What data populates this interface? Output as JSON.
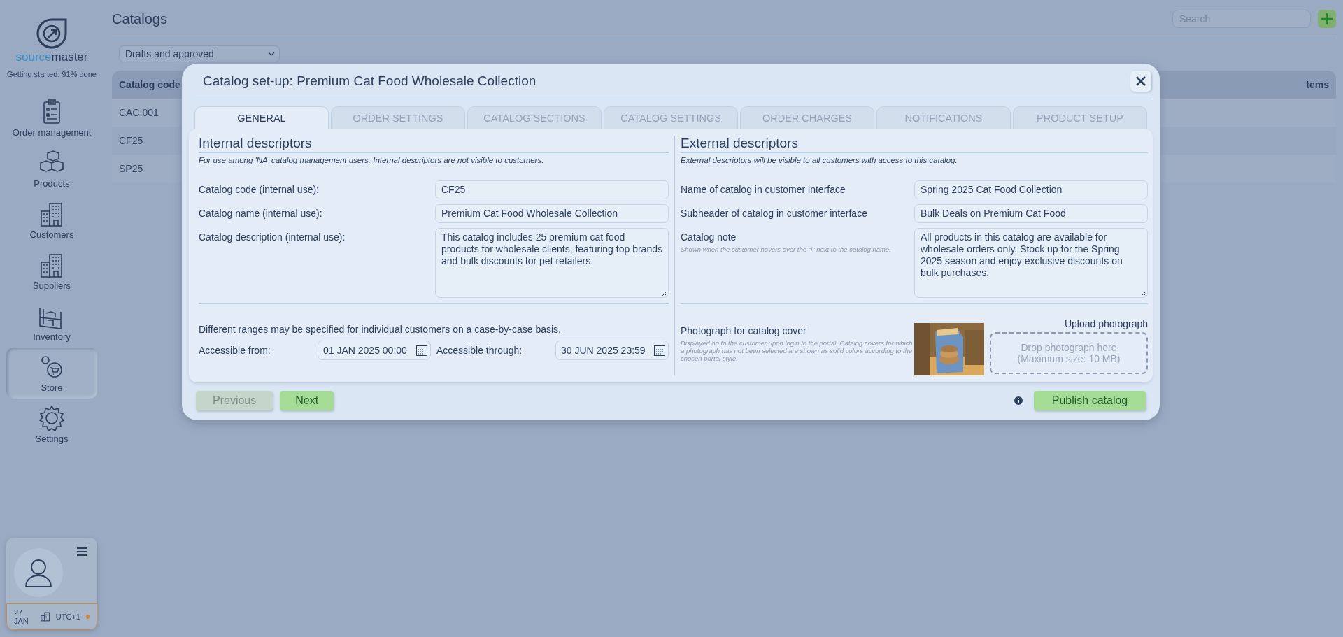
{
  "sidebar": {
    "logo": {
      "part_1": "source",
      "part_2": "master"
    },
    "getting_started": "Getting started: 91% done",
    "nav": [
      {
        "label": "Order management",
        "selected": false
      },
      {
        "label": "Products",
        "selected": false
      },
      {
        "label": "Customers",
        "selected": false
      },
      {
        "label": "Suppliers",
        "selected": false
      },
      {
        "label": "Inventory",
        "selected": false
      },
      {
        "label": "Store",
        "selected": true
      },
      {
        "label": "Settings",
        "selected": false
      }
    ],
    "user": {
      "date": "27 JAN",
      "timezone": "UTC+1"
    }
  },
  "page": {
    "title": "Catalogs",
    "search": {
      "placeholder": "Search"
    },
    "filter": "Drafts and approved",
    "table": {
      "columns": [
        "Catalog code",
        "tems"
      ],
      "rows": [
        [
          "CAC.001"
        ],
        [
          "CF25"
        ],
        [
          "SP25"
        ]
      ]
    }
  },
  "modal": {
    "title": "Catalog set-up: Premium Cat Food Wholesale Collection",
    "tabs": [
      {
        "label": "GENERAL",
        "selected": true
      },
      {
        "label": "ORDER SETTINGS",
        "selected": false
      },
      {
        "label": "CATALOG SECTIONS",
        "selected": false
      },
      {
        "label": "CATALOG SETTINGS",
        "selected": false
      },
      {
        "label": "ORDER CHARGES",
        "selected": false
      },
      {
        "label": "NOTIFICATIONS",
        "selected": false
      },
      {
        "label": "PRODUCT SETUP",
        "selected": false
      }
    ],
    "internal": {
      "heading": "Internal descriptors",
      "note": "For use among 'NA' catalog management users. Internal descriptors are not visible to customers.",
      "fields": [
        {
          "kind": "input",
          "label": "Catalog code (internal use):",
          "value": "CF25"
        },
        {
          "kind": "input",
          "label": "Catalog name (internal use):",
          "value": "Premium Cat Food Wholesale Collection"
        },
        {
          "kind": "textarea",
          "label": "Catalog description (internal use):",
          "value": "This catalog includes 25 premium cat food products for wholesale clients, featuring top brands and bulk discounts for pet retailers."
        }
      ],
      "range_note": "Different ranges may be specified for individual customers on a case-by-case basis.",
      "from_label": "Accessible from:",
      "from_value": "01 JAN 2025 00:00",
      "through_label": "Accessible through:",
      "through_value": "30 JUN 2025 23:59"
    },
    "external": {
      "heading": "External descriptors",
      "note": "External descriptors will be visible to all customers with access to this catalog.",
      "fields": [
        {
          "kind": "input",
          "label": "Name of catalog in customer interface",
          "value": "Spring 2025 Cat Food Collection"
        },
        {
          "kind": "input",
          "label": "Subheader of catalog in customer interface",
          "value": "Bulk Deals on Premium Cat Food"
        },
        {
          "kind": "textarea",
          "label": "Catalog note",
          "hint": "Shown when the customer hovers over the \"i\" next to the catalog name.",
          "value": "All products in this catalog are available for wholesale orders only. Stock up for the Spring 2025 season and enjoy exclusive discounts on bulk purchases."
        }
      ],
      "cover": {
        "label": "Photograph for catalog cover",
        "hint": "Displayed on to the customer upon login to the portal. Catalog covers for which a photograph has not been selected are shown as solid colors according to the chosen portal style.",
        "photo": {
          "kind": "picture"
        },
        "upload_label": "Upload photograph",
        "drop_text": [
          "Drop photograph here",
          "(Maximum size: 10 MB)"
        ]
      }
    },
    "buttons": {
      "previous": {
        "label": "Previous",
        "disabled": true
      },
      "next": {
        "label": "Next",
        "disabled": false
      },
      "publish": {
        "label": "Publish catalog",
        "disabled": false
      }
    }
  }
}
